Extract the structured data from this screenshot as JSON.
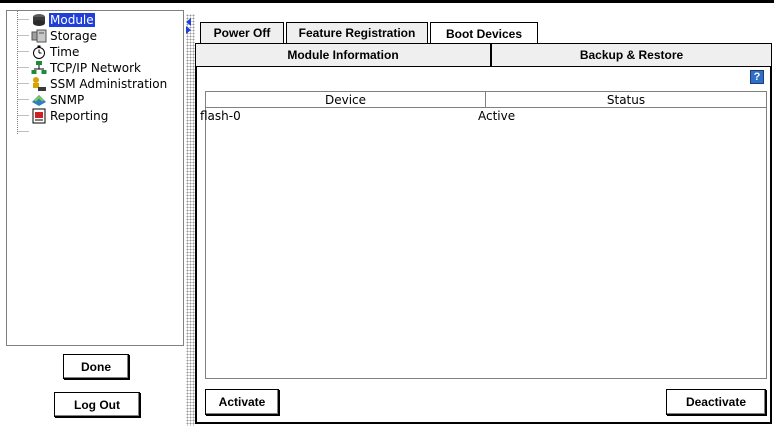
{
  "tree": {
    "items": [
      {
        "label": "Module",
        "icon": "module-icon",
        "selected": true
      },
      {
        "label": "Storage",
        "icon": "storage-icon"
      },
      {
        "label": "Time",
        "icon": "clock-icon"
      },
      {
        "label": "TCP/IP Network",
        "icon": "network-icon"
      },
      {
        "label": "SSM Administration",
        "icon": "admin-icon"
      },
      {
        "label": "SNMP",
        "icon": "snmp-icon"
      },
      {
        "label": "Reporting",
        "icon": "report-icon"
      }
    ]
  },
  "buttons": {
    "done": "Done",
    "logout": "Log Out",
    "activate": "Activate",
    "deactivate": "Deactivate"
  },
  "tabs": {
    "row1": [
      "Power Off",
      "Feature Registration",
      "Boot Devices"
    ],
    "row2": [
      "Module Information",
      "Backup & Restore"
    ],
    "active": "Boot Devices"
  },
  "help": "?",
  "table": {
    "columns": [
      "Device",
      "Status"
    ],
    "rows": [
      {
        "device": "flash-0",
        "status": "Active"
      }
    ]
  },
  "colors": {
    "selection": "#1f3fd8",
    "help": "#2f6fc5"
  }
}
